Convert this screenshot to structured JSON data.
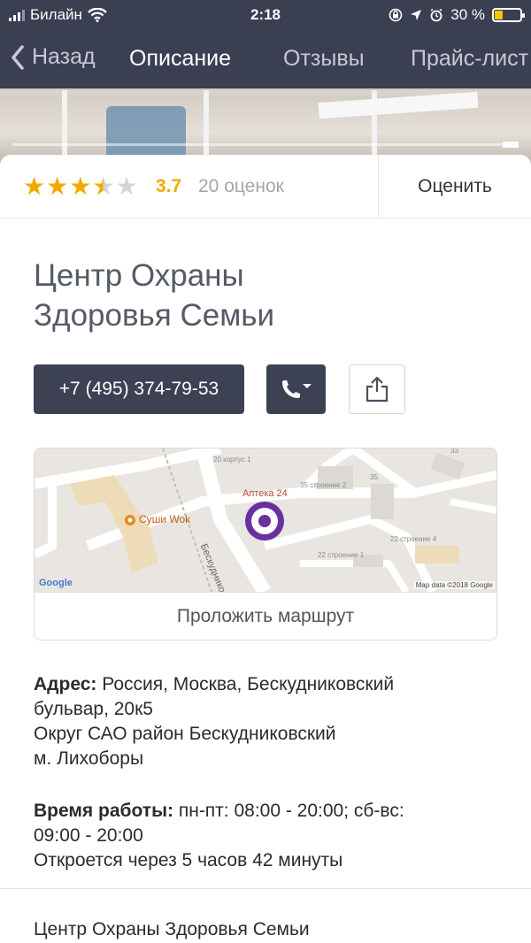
{
  "status_bar": {
    "carrier": "Билайн",
    "time": "2:18",
    "battery": "30 %"
  },
  "nav": {
    "back_label": "Назад",
    "tabs": [
      {
        "label": "Описание",
        "active": true
      },
      {
        "label": "Отзывы",
        "active": false
      },
      {
        "label": "Прайс-лист",
        "active": false
      }
    ]
  },
  "rating": {
    "value": "3.7",
    "stars_filled": 3.5,
    "stars_total": 5,
    "count_label": "20 оценок",
    "rate_button": "Оценить"
  },
  "place": {
    "title_line1": "Центр Охраны",
    "title_line2": "Здоровья Семьи",
    "phone": "+7 (495) 374-79-53"
  },
  "map": {
    "pharmacy": "Аптека 24",
    "restaurant": "Суши Wok",
    "street": "Бескудниковский",
    "labels": [
      "20 корпус 1",
      "35 строение 2",
      "35",
      "33",
      "22 строение 4",
      "22 строение 1"
    ],
    "google": "Google",
    "credit": "Map data ©2018 Google",
    "route_button": "Проложить маршрут"
  },
  "address": {
    "label": "Адрес:",
    "line1": " Россия, Москва, Бескудниковский",
    "line2": "бульвар, 20к5",
    "district": "Округ САО район Бескудниковский",
    "metro": "м. Лихоборы"
  },
  "hours": {
    "label": "Время работы:",
    "line1": " пн-пт: 08:00 - 20:00; сб-вс:",
    "line2": "09:00 - 20:00",
    "open_note": "Откроется через 5 часов 42 минуты"
  },
  "footer": {
    "name": "Центр Охраны Здоровья Семьи"
  },
  "colors": {
    "nav_bg": "#3a3f52",
    "button_dark": "#3c4154",
    "star": "#f2a900",
    "map_pin": "#6b2fa0"
  }
}
